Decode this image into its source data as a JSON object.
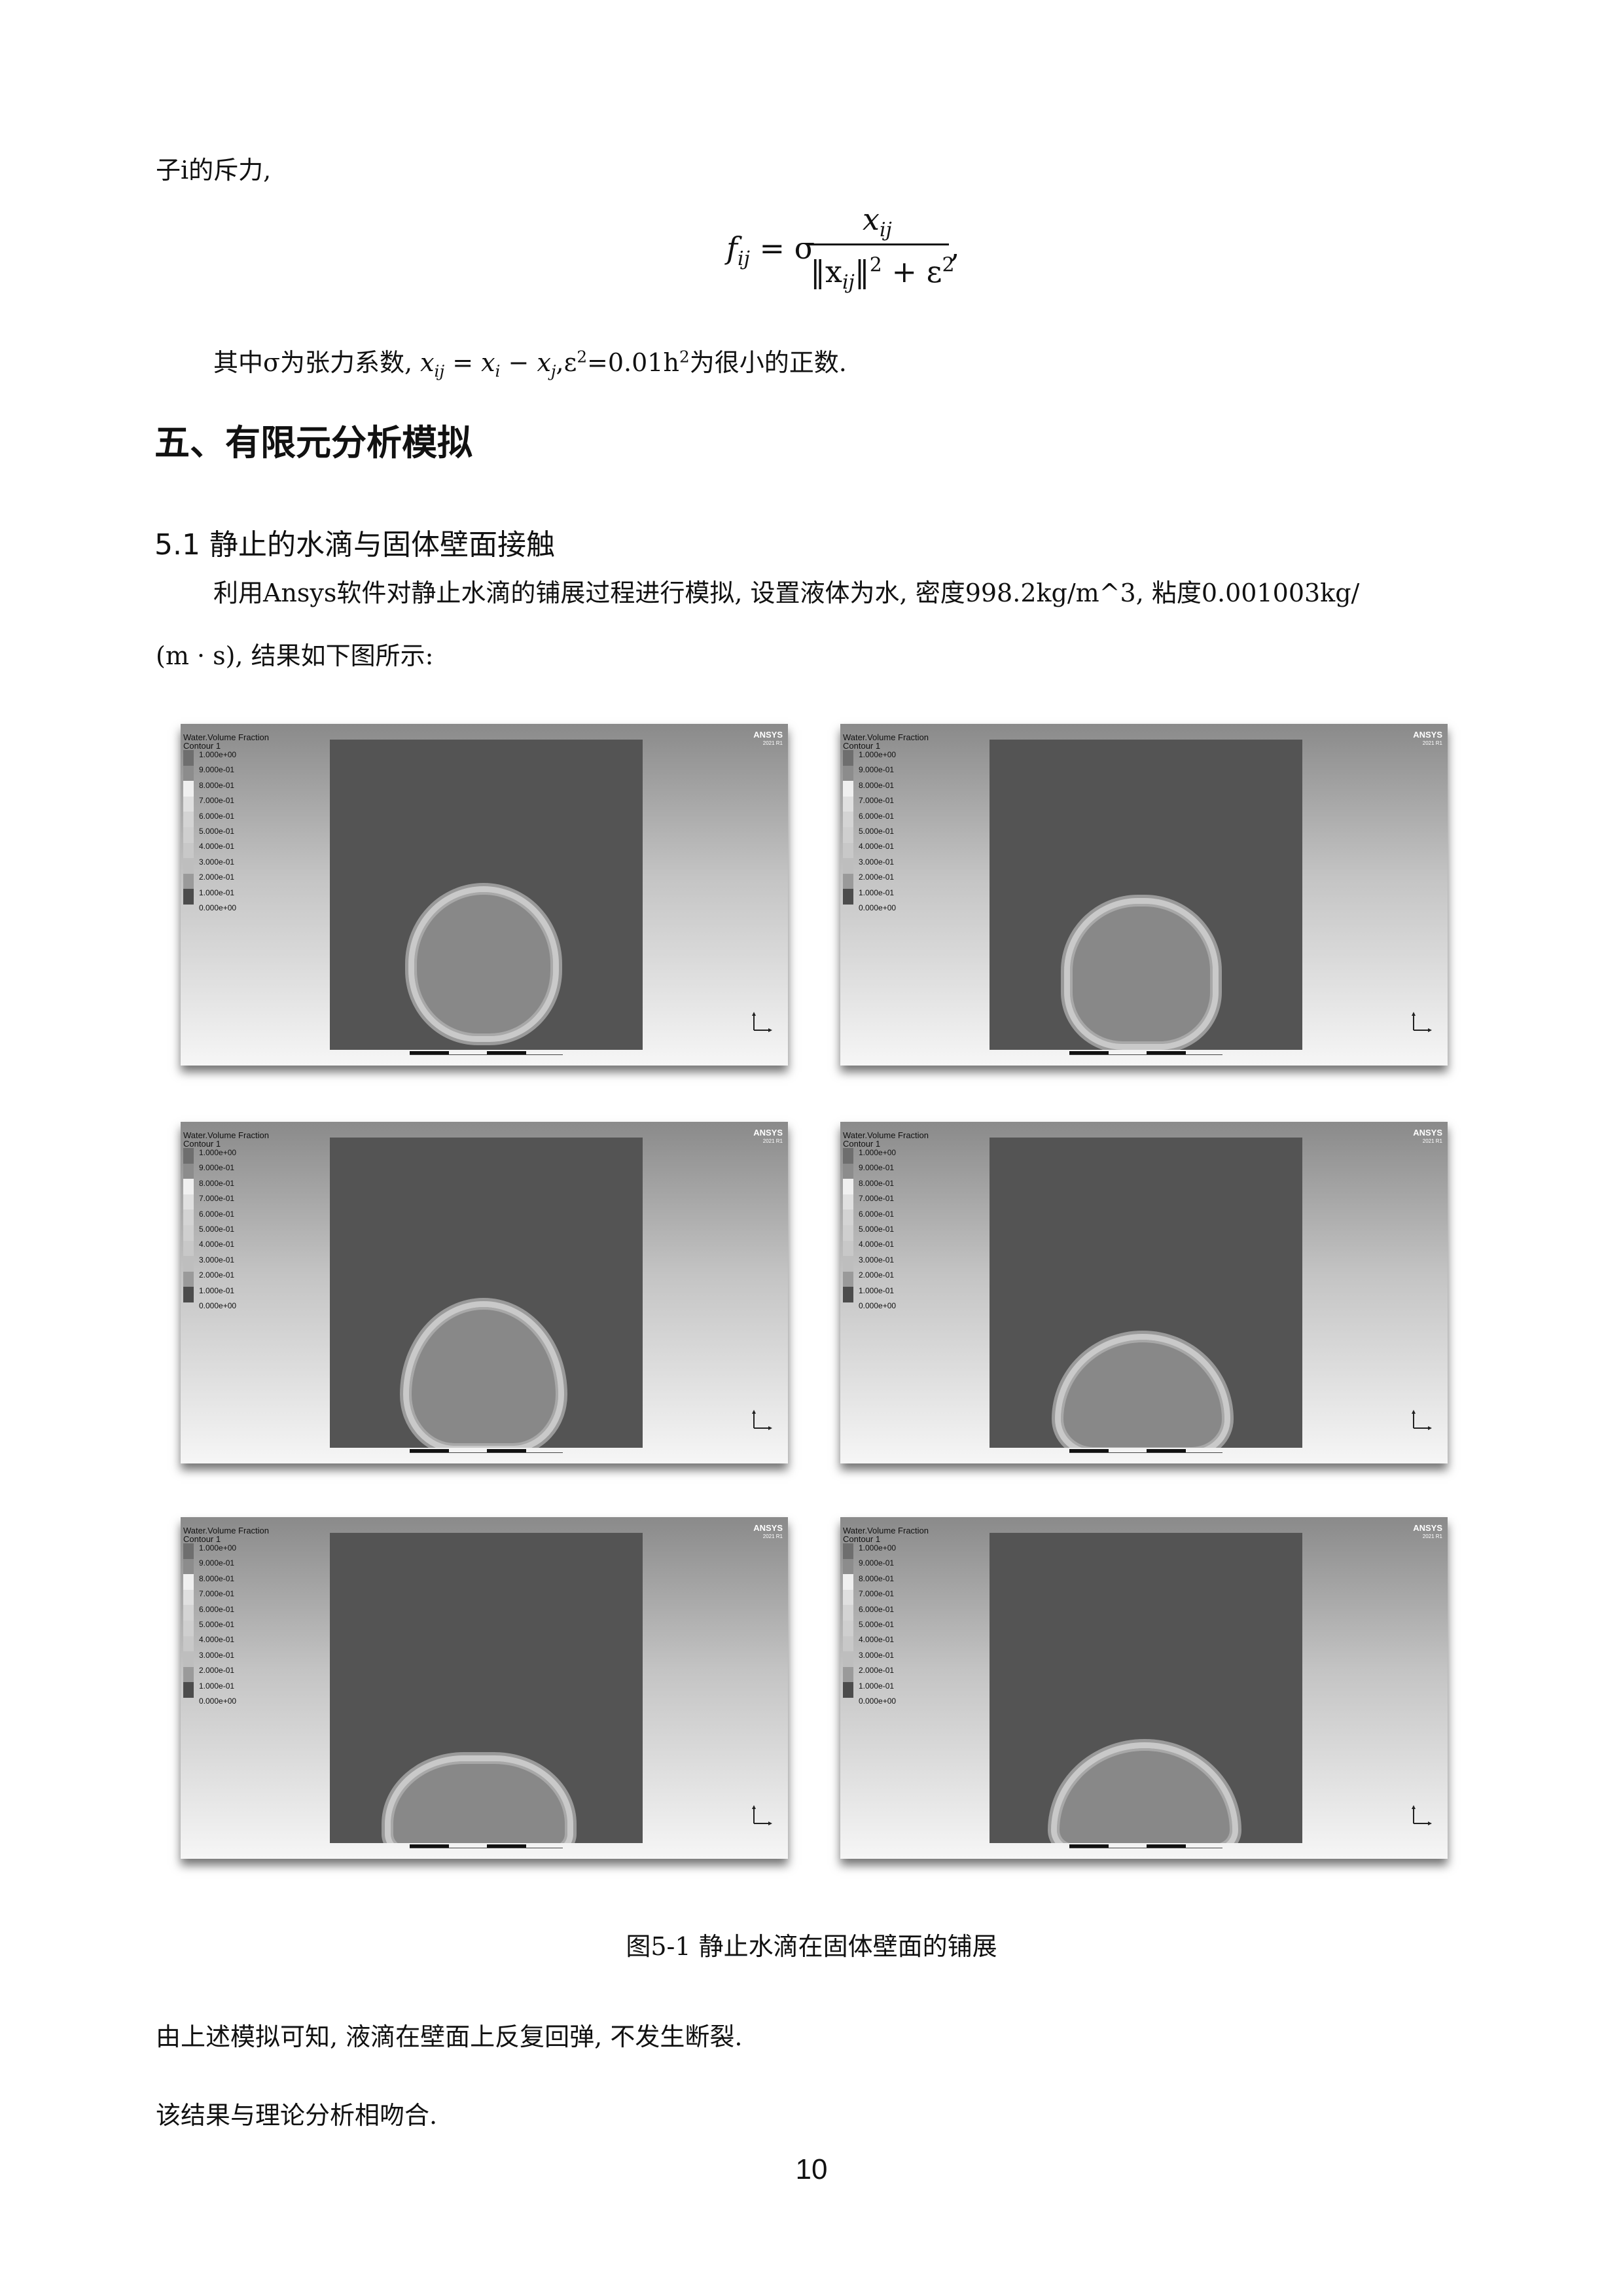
{
  "intro_line": "子i的斥力,",
  "formula": {
    "lhs": "f",
    "lhs_sub": "ij",
    "eq": "= σ",
    "num": "x",
    "num_sub": "ij",
    "den_open": "‖x",
    "den_sub": "ij",
    "den_close": "‖",
    "den_sq": "2",
    "den_rest": "+ ε",
    "den_eps_sq": "2",
    "trail": ","
  },
  "where_line": {
    "p1": "其中σ为张力系数, ",
    "x": "x",
    "x_sub": "ij",
    "mid": " = x",
    "xi_sub": "i",
    "minus": " − x",
    "xj_sub": "j",
    "comma": ",ε",
    "eps_sup": "2",
    "eq": "=0.01h",
    "h_sup": "2",
    "tail": "为很小的正数."
  },
  "section_title": "五、有限元分析模拟",
  "subsection_title": "5.1 静止的水滴与固体壁面接触",
  "para_line1": "利用Ansys软件对静止水滴的铺展过程进行模拟, 设置液体为水, 密度998.2kg/m^3, 粘度0.001003kg/",
  "para_line2": "(m · s), 结果如下图所示:",
  "panel_legend": {
    "title_line1": "Water.Volume Fraction",
    "title_line2": "Contour 1",
    "labels": [
      "1.000e+00",
      "9.000e-01",
      "8.000e-01",
      "7.000e-01",
      "6.000e-01",
      "5.000e-01",
      "4.000e-01",
      "3.000e-01",
      "2.000e-01",
      "1.000e-01",
      "0.000e+00"
    ],
    "bar_colors": [
      "#6e6e6e",
      "#8c8c8c",
      "#f0f0f0",
      "#e0e0e0",
      "#d4d4d4",
      "#cfcfcf",
      "#c8c8c8",
      "#bebebe",
      "#9a9a9a",
      "#4c4c4c"
    ]
  },
  "brand": {
    "name": "ANSYS",
    "version": "2021 R1"
  },
  "figure_caption": "图5-1 静止水滴在固体壁面的铺展",
  "conclusion1": "由上述模拟可知, 液滴在壁面上反复回弹, 不发生断裂.",
  "conclusion2": "该结果与理论分析相吻合.",
  "page_number": "10"
}
